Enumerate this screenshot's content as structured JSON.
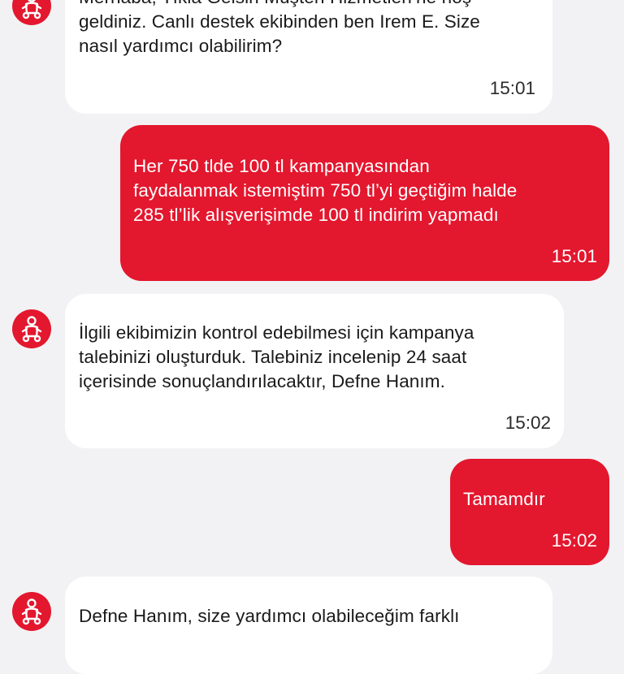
{
  "theme": {
    "accent": "#e3172e",
    "background": "#f2f2f4",
    "incoming_bubble": "#ffffff",
    "outgoing_bubble": "#e3172e"
  },
  "agent": {
    "avatar_icon": "scooter-courier-icon"
  },
  "messages": [
    {
      "sender": "agent",
      "text": "Merhaba, Tıkla Gelsin Müşteri Hizmetleri’ne hoş\ngeldiniz. Canlı destek ekibinden ben Irem E. Size\nnasıl yardımcı olabilirim?",
      "time": "15:01"
    },
    {
      "sender": "user",
      "text": "Her 750 tlde 100 tl kampanyasından\nfaydalanmak istemiştim 750 tl’yi geçtiğim halde\n285 tl’lik alışverişimde 100 tl indirim yapmadı",
      "time": "15:01"
    },
    {
      "sender": "agent",
      "text": "İlgili ekibimizin kontrol edebilmesi için kampanya\ntalebinizi oluşturduk. Talebiniz incelenip 24 saat\niçerisinde sonuçlandırılacaktır, Defne Hanım.",
      "time": "15:02"
    },
    {
      "sender": "user",
      "text": "Tamamdır",
      "time": "15:02"
    },
    {
      "sender": "agent",
      "text": "Defne Hanım, size yardımcı olabileceğim farklı",
      "time": ""
    }
  ]
}
